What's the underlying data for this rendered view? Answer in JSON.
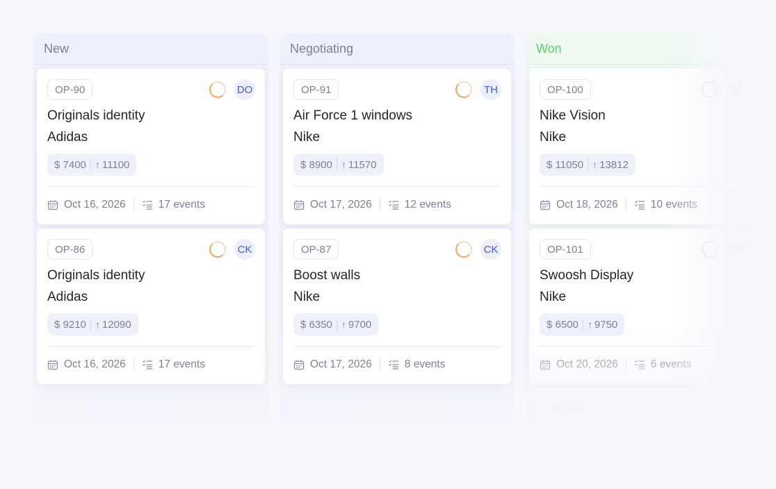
{
  "columns": [
    {
      "title": "New",
      "cards": [
        {
          "id": "OP-90",
          "avatar": "DO",
          "title": "Originals identity",
          "company": "Adidas",
          "amount": "7400",
          "target": "11100",
          "date": "Oct 16, 2026",
          "events": "17 events"
        },
        {
          "id": "OP-86",
          "avatar": "CK",
          "title": "Originals identity",
          "company": "Adidas",
          "amount": "9210",
          "target": "12090",
          "date": "Oct 16, 2026",
          "events": "17 events"
        }
      ]
    },
    {
      "title": "Negotiating",
      "cards": [
        {
          "id": "OP-91",
          "avatar": "TH",
          "title": "Air Force 1 windows",
          "company": "Nike",
          "amount": "8900",
          "target": "11570",
          "date": "Oct 17, 2026",
          "events": "12 events"
        },
        {
          "id": "OP-87",
          "avatar": "CK",
          "title": "Boost walls",
          "company": "Nike",
          "amount": "6350",
          "target": "9700",
          "date": "Oct 17, 2026",
          "events": "8 events"
        }
      ]
    },
    {
      "title": "Won",
      "cards": [
        {
          "id": "OP-100",
          "avatar": "VI",
          "title": "Nike Vision",
          "company": "Nike",
          "amount": "11050",
          "target": "13812",
          "date": "Oct 18, 2026",
          "events": "10 events"
        },
        {
          "id": "OP-101",
          "avatar": "TH",
          "title": "Swoosh Display",
          "company": "Nike",
          "amount": "6500",
          "target": "9750",
          "date": "Oct 20, 2026",
          "events": "6 events"
        },
        {
          "id": "OP-102"
        }
      ]
    }
  ],
  "currency_symbol": "$",
  "colors": {
    "accent": "#4a5bd0",
    "won": "#5ccf6c",
    "progress": "#f2a45b"
  }
}
